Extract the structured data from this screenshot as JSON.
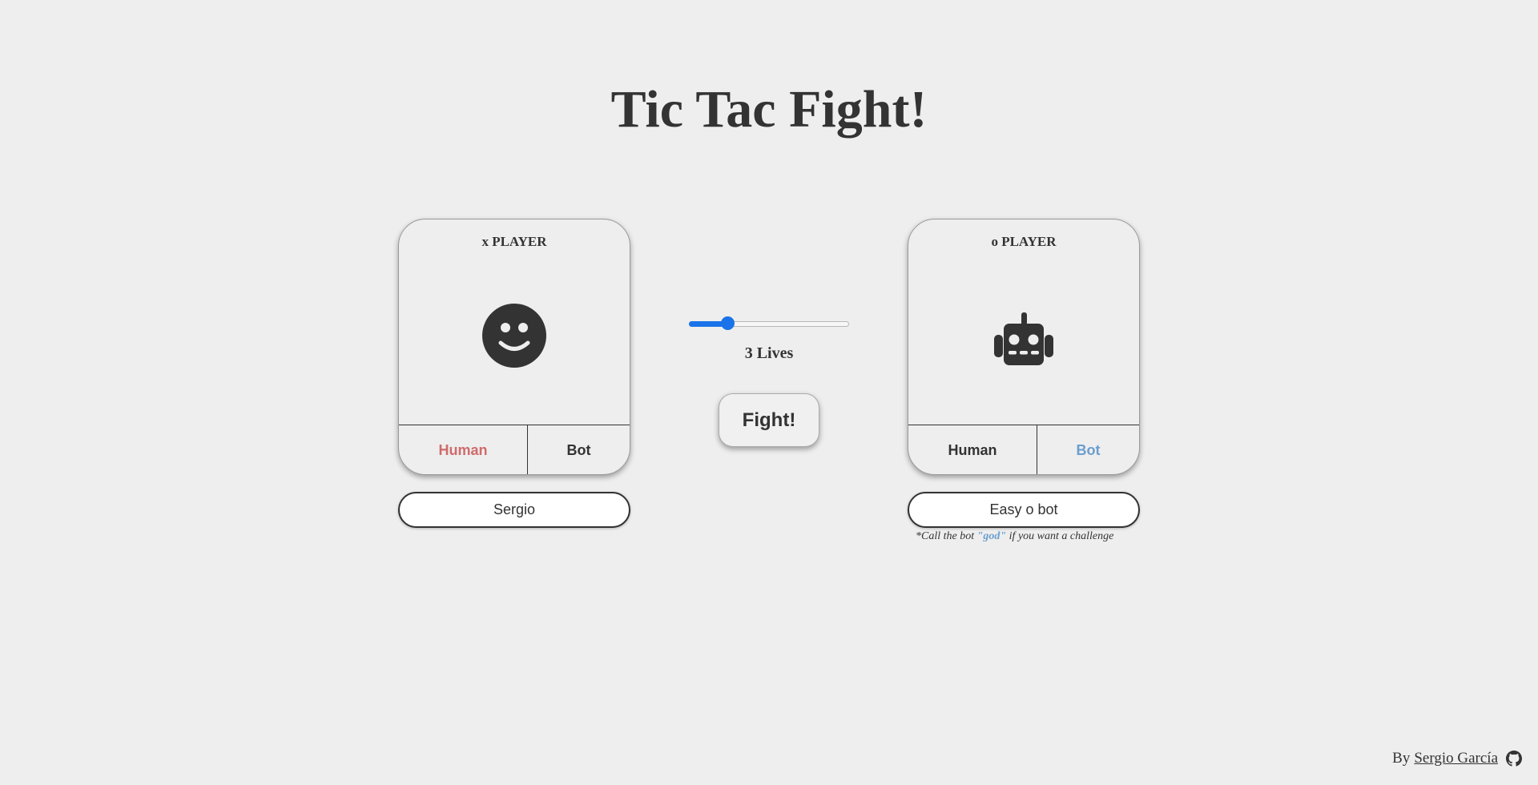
{
  "title": "Tic Tac Fight!",
  "colors": {
    "background": "#eeeeee",
    "text": "#333333",
    "human_active": "#cf6b6b",
    "bot_active": "#6a9ecf",
    "slider": "#1a73e8"
  },
  "x_player": {
    "label": "x PLAYER",
    "avatar_icon": "smiley-face-icon",
    "mode_options": [
      "Human",
      "Bot"
    ],
    "selected_mode": "Human",
    "name_value": "Sergio"
  },
  "o_player": {
    "label": "o PLAYER",
    "avatar_icon": "robot-icon",
    "mode_options": [
      "Human",
      "Bot"
    ],
    "selected_mode": "Bot",
    "name_value": "Easy o bot",
    "hint_prefix": "*Call the bot ",
    "hint_highlight": "\"god\"",
    "hint_suffix": " if you want a challenge"
  },
  "lives": {
    "value": 3,
    "min": 1,
    "max": 10,
    "label": "3 Lives"
  },
  "fight_button": "Fight!",
  "footer": {
    "prefix": "By",
    "author": "Sergio García",
    "icon": "github-icon"
  }
}
